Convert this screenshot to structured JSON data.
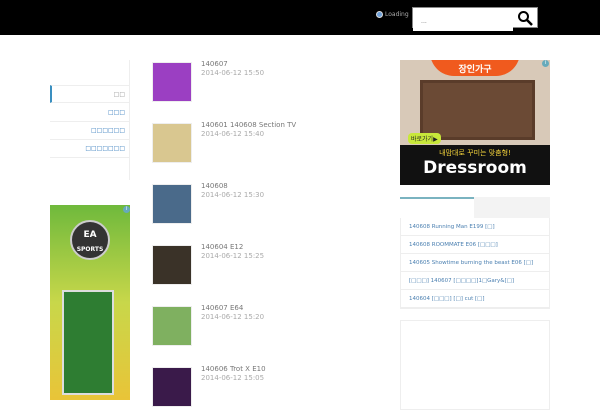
{
  "header": {
    "loading_text": "Loading",
    "search_placeholder": "..."
  },
  "sidebar": {
    "items": [
      {
        "label": "□□"
      },
      {
        "label": "□□□"
      },
      {
        "label": "□□□□□□"
      },
      {
        "label": "□□□□□□□"
      }
    ]
  },
  "left_ad": {
    "brand": "EA SPORTS"
  },
  "posts": [
    {
      "title": "140607",
      "date": "2014-06-12 15:50",
      "color": "#9b3fc2"
    },
    {
      "title": "140601 140608 Section TV",
      "date": "2014-06-12 15:40",
      "color": "#d9c790"
    },
    {
      "title": "140608",
      "date": "2014-06-12 15:30",
      "color": "#4a6a8a"
    },
    {
      "title": "140604       E12",
      "date": "2014-06-12 15:25",
      "color": "#3a3228"
    },
    {
      "title": "140607       E64",
      "date": "2014-06-12 15:20",
      "color": "#7fb060"
    },
    {
      "title": "140606 Trot X E10",
      "date": "2014-06-12 15:05",
      "color": "#3a1a4a"
    }
  ],
  "right_ad": {
    "top_text": "장인가구",
    "button": "바로가기▶",
    "tagline": "내맘대로 꾸미는 맞춤형!",
    "brand": "Dressroom"
  },
  "popular": [
    "140608 Running Man E199 [□]",
    "140608 ROOMMATE E06 [□□□]",
    "140605 Showtime burning the beast E06 [□]",
    "[□□□] 140607 [□□□□]1□Gary&[□]",
    "140604 [□□□] [□] cut [□]"
  ]
}
